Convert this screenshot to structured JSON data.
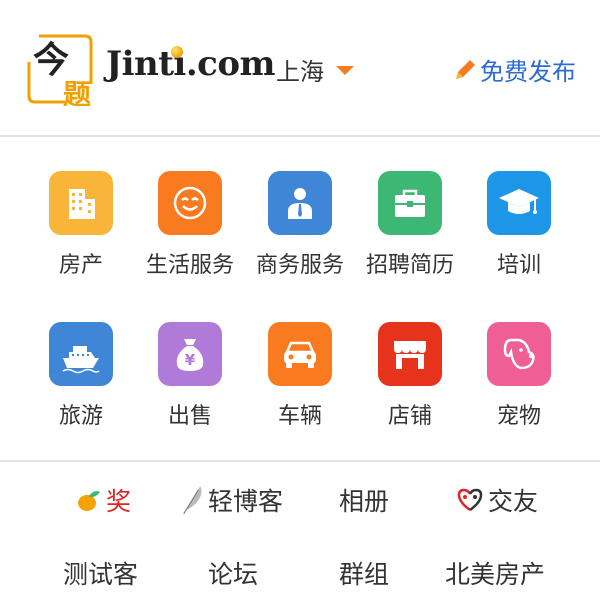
{
  "header": {
    "logo_text_top": "今",
    "logo_text_bottom": "题",
    "brand": "Jinti.com",
    "city": "上海",
    "post_label": "免费发布"
  },
  "categories": [
    {
      "label": "房产",
      "icon": "building-icon",
      "color": "#f9b43a"
    },
    {
      "label": "生活服务",
      "icon": "smiley-icon",
      "color": "#f97a1f"
    },
    {
      "label": "商务服务",
      "icon": "businessman-icon",
      "color": "#3f86d6"
    },
    {
      "label": "招聘简历",
      "icon": "briefcase-icon",
      "color": "#3cb874"
    },
    {
      "label": "培训",
      "icon": "graduation-cap-icon",
      "color": "#1e96e8"
    },
    {
      "label": "旅游",
      "icon": "ship-icon",
      "color": "#3f86d6"
    },
    {
      "label": "出售",
      "icon": "money-bag-icon",
      "color": "#b07ad9"
    },
    {
      "label": "车辆",
      "icon": "car-icon",
      "color": "#f97a1f"
    },
    {
      "label": "店铺",
      "icon": "storefront-icon",
      "color": "#e6331c"
    },
    {
      "label": "宠物",
      "icon": "dog-icon",
      "color": "#ef5f96"
    }
  ],
  "links_row1": [
    {
      "label": "奖",
      "icon": "fruit-icon",
      "color": "#e02424"
    },
    {
      "label": "轻博客",
      "icon": "feather-icon",
      "color": "#333333"
    },
    {
      "label": "相册",
      "icon": "",
      "color": "#333333"
    },
    {
      "label": "交友",
      "icon": "heart-people-icon",
      "color": "#333333"
    }
  ],
  "links_row2": [
    {
      "label": "测试客"
    },
    {
      "label": "论坛"
    },
    {
      "label": "群组"
    },
    {
      "label": "北美房产"
    }
  ]
}
